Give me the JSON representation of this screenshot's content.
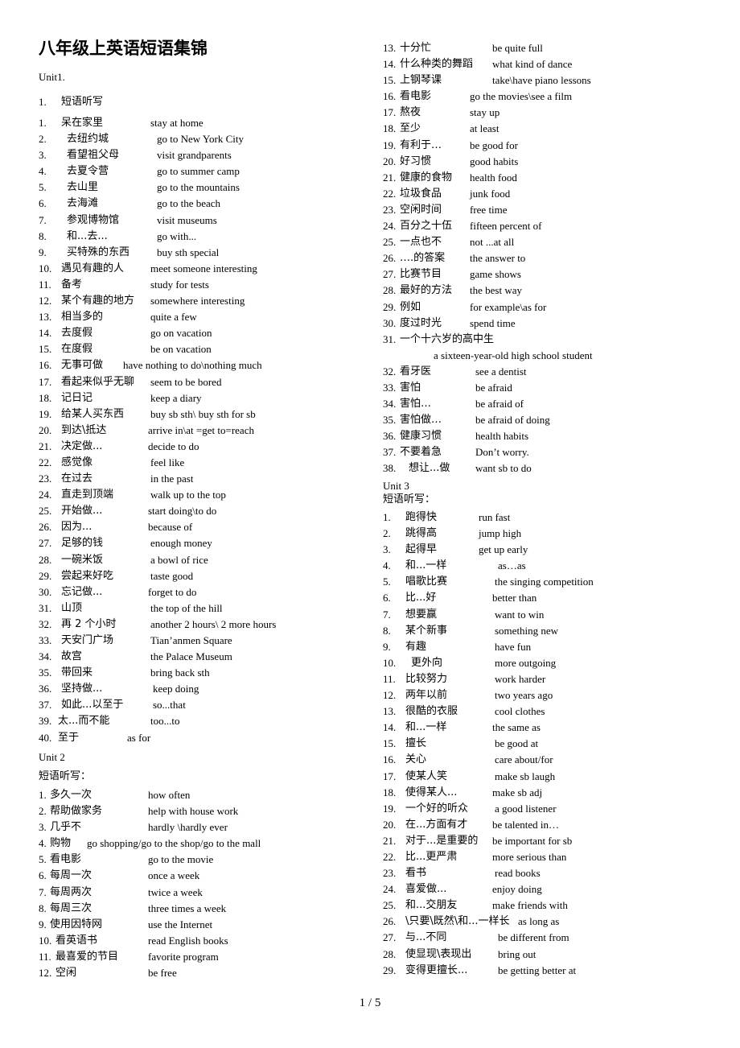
{
  "title": "八年级上英语短语集锦",
  "unit1": {
    "heading": "Unit1.",
    "section_num": "1.",
    "section_label": "短语听写",
    "items": [
      [
        "1.",
        "呆在家里",
        "stay at home"
      ],
      [
        "2.",
        "去纽约城",
        "go to New York City"
      ],
      [
        "3.",
        "看望祖父母",
        "visit grandparents"
      ],
      [
        "4.",
        "去夏令营",
        "go to summer camp"
      ],
      [
        "5.",
        "去山里",
        "go to the mountains"
      ],
      [
        "6.",
        "去海滩",
        "go to the beach"
      ],
      [
        "7.",
        "参观博物馆",
        "visit museums"
      ],
      [
        "8.",
        "和...去...",
        "go with..."
      ],
      [
        "9.",
        "买特殊的东西",
        "buy sth special"
      ],
      [
        "10.",
        "遇见有趣的人",
        "meet someone interesting"
      ],
      [
        "11.",
        "备考",
        "study for tests"
      ],
      [
        "12.",
        "某个有趣的地方",
        "somewhere interesting"
      ],
      [
        "13.",
        "相当多的",
        "quite a few"
      ],
      [
        "14.",
        "去度假",
        "go on vacation"
      ],
      [
        "15.",
        "在度假",
        "be on vacation"
      ],
      [
        "16.",
        "无事可做",
        "have nothing to do\\nothing much"
      ],
      [
        "17.",
        "看起来似乎无聊",
        "seem to be bored"
      ],
      [
        "18.",
        "记日记",
        "keep a diary"
      ],
      [
        "19.",
        "给某人买东西",
        "buy sb sth\\ buy sth for sb"
      ],
      [
        "20.",
        "到达\\抵达",
        "arrive in\\at =get to=reach"
      ],
      [
        "21.",
        "决定做...",
        "decide to do"
      ],
      [
        "22.",
        "感觉像",
        "feel like"
      ],
      [
        "23.",
        "在过去",
        "in the past"
      ],
      [
        "24.",
        "直走到顶端",
        "walk up to the top"
      ],
      [
        "25.",
        "开始做...",
        "start doing\\to do"
      ],
      [
        "26.",
        "因为...",
        "because of"
      ],
      [
        "27.",
        "足够的钱",
        "enough money"
      ],
      [
        "28.",
        "一碗米饭",
        "a bowl of rice"
      ],
      [
        "29.",
        "尝起来好吃",
        "taste good"
      ],
      [
        "30.",
        "忘记做...",
        "forget to do"
      ],
      [
        "31.",
        "山顶",
        "the top of the hill"
      ],
      [
        "32.",
        "再 2 个小时",
        "another 2 hours\\ 2 more hours"
      ],
      [
        "33.",
        "天安门广场",
        "Tian’anmen Square"
      ],
      [
        "34.",
        "故宫",
        "the Palace Museum"
      ],
      [
        "35.",
        "带回来",
        "bring back sth"
      ],
      [
        "36.",
        "坚持做...",
        "keep doing"
      ],
      [
        "37.",
        "如此...以至于",
        "so...that"
      ],
      [
        "39.",
        "太...而不能",
        "too...to"
      ],
      [
        "40.",
        "至于",
        "as for"
      ]
    ]
  },
  "unit2": {
    "heading": "Unit 2",
    "section_label": "短语听写：",
    "items": [
      [
        "1.",
        "多久一次",
        "how often"
      ],
      [
        "2.",
        "帮助做家务",
        "help with house work"
      ],
      [
        "3.",
        "几乎不",
        "hardly \\hardly ever"
      ],
      [
        "4.",
        "购物",
        "go shopping/go to the shop/go to the mall"
      ],
      [
        "5.",
        "看电影",
        "go to the movie"
      ],
      [
        "6.",
        "每周一次",
        "once a week"
      ],
      [
        "7.",
        "每周两次",
        "twice a week"
      ],
      [
        "8.",
        "每周三次",
        "three times a week"
      ],
      [
        "9.",
        "使用因特网",
        "use the Internet"
      ],
      [
        "10.",
        "看英语书",
        "read English books"
      ],
      [
        "11.",
        "最喜爱的节目",
        "favorite program"
      ],
      [
        "12.",
        "空闲",
        "be free"
      ],
      [
        "13.",
        "十分忙",
        "be quite full"
      ],
      [
        "14.",
        "什么种类的舞蹈",
        "what kind of dance"
      ],
      [
        "15.",
        "上钢琴课",
        "take\\have piano lessons"
      ],
      [
        "16.",
        "看电影",
        "go the movies\\see a film"
      ],
      [
        "17.",
        "熬夜",
        "stay up"
      ],
      [
        "18.",
        "至少",
        "at least"
      ],
      [
        "19.",
        "有利于…",
        "be good for"
      ],
      [
        "20.",
        "好习惯",
        "good habits"
      ],
      [
        "21.",
        "健康的食物",
        "health food"
      ],
      [
        "22.",
        "垃圾食品",
        "junk food"
      ],
      [
        "23.",
        "空闲时间",
        "free time"
      ],
      [
        "24.",
        "百分之十伍",
        "fifteen percent of"
      ],
      [
        "25.",
        "一点也不",
        "not ...at all"
      ],
      [
        "26.",
        "….的答案",
        "the answer to"
      ],
      [
        "27.",
        "比赛节目",
        "game shows"
      ],
      [
        "28.",
        "最好的方法",
        "the best way"
      ],
      [
        "29.",
        "例如",
        "for example\\as for"
      ],
      [
        "30.",
        "度过时光",
        "spend time"
      ],
      [
        "31.",
        "一个十六岁的高中生",
        "a sixteen-year-old high school student"
      ],
      [
        "32.",
        "看牙医",
        "see a dentist"
      ],
      [
        "33.",
        "害怕",
        "be afraid"
      ],
      [
        "34.",
        "害怕…",
        "be afraid of"
      ],
      [
        "35.",
        "害怕做…",
        "be afraid of doing"
      ],
      [
        "36.",
        "健康习惯",
        "health habits"
      ],
      [
        "37.",
        "不要着急",
        "Don’t worry."
      ],
      [
        "38. ",
        "想让...做",
        "want sb to do"
      ]
    ]
  },
  "unit3": {
    "heading": "Unit 3",
    "section_label": "短语听写：",
    "items": [
      [
        "1.",
        "跑得快",
        "run fast"
      ],
      [
        "2.",
        "跳得高",
        "jump high"
      ],
      [
        "3.",
        "起得早",
        "get up early"
      ],
      [
        "4.",
        "和...一样",
        "as…as"
      ],
      [
        "5.",
        "唱歌比赛",
        "the singing competition"
      ],
      [
        "6.",
        "比...好",
        "better than"
      ],
      [
        "7.",
        "想要赢",
        "want to win"
      ],
      [
        "8.",
        "某个新事",
        "something new"
      ],
      [
        "9.",
        "有趣",
        "have fun"
      ],
      [
        "10.",
        "更外向",
        "more outgoing"
      ],
      [
        "11.",
        "比较努力",
        "work harder"
      ],
      [
        "12.",
        "两年以前",
        "two years ago"
      ],
      [
        "13.",
        "很酷的衣服",
        "cool clothes"
      ],
      [
        "14.",
        "和...一样",
        "the same as"
      ],
      [
        "15.",
        "擅长",
        "be good at"
      ],
      [
        "16.",
        "关心",
        "care about/for"
      ],
      [
        "17.",
        "使某人笑",
        "make sb laugh"
      ],
      [
        "18.",
        "使得某人...",
        "make sb adj"
      ],
      [
        "19.",
        "一个好的听众",
        "a good listener"
      ],
      [
        "20.",
        "在...方面有才",
        "be talented in…"
      ],
      [
        "21.",
        "对于...是重要的",
        "be important for sb"
      ],
      [
        "22.",
        "比...更严肃",
        "more serious than"
      ],
      [
        "23.",
        "看书",
        "read books"
      ],
      [
        "24.",
        "喜爱做...",
        "enjoy doing"
      ],
      [
        "25.",
        "和...交朋友",
        "make friends with"
      ],
      [
        "26.",
        "\\只要\\既然\\和...一样长",
        "as long as"
      ],
      [
        "27.",
        "与...不同",
        "be different from"
      ],
      [
        "28.",
        "使显现\\表现出",
        "bring out"
      ],
      [
        "29.",
        "变得更擅长...",
        "be getting better at"
      ]
    ]
  },
  "footer": {
    "page": "1 / 5"
  }
}
